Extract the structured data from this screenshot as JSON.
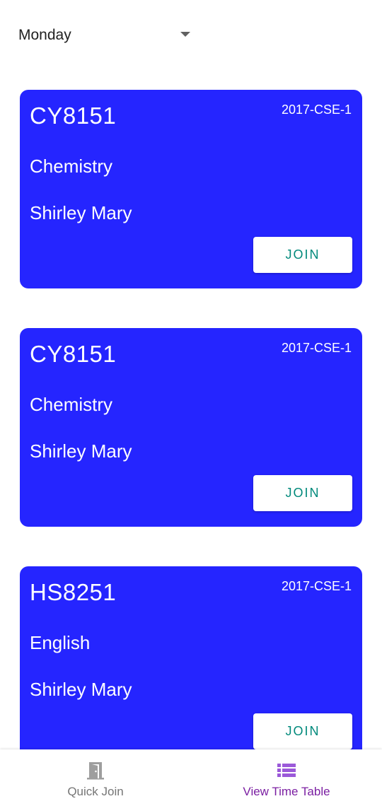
{
  "day_selector": {
    "selected": "Monday"
  },
  "classes": [
    {
      "code": "CY8151",
      "batch": "2017-CSE-1",
      "subject": "Chemistry",
      "teacher": "Shirley Mary",
      "join_label": "JOIN"
    },
    {
      "code": "CY8151",
      "batch": "2017-CSE-1",
      "subject": "Chemistry",
      "teacher": "Shirley Mary",
      "join_label": "JOIN"
    },
    {
      "code": "HS8251",
      "batch": "2017-CSE-1",
      "subject": "English",
      "teacher": "Shirley Mary",
      "join_label": "JOIN"
    }
  ],
  "bottom_nav": {
    "items": [
      {
        "label": "Quick Join",
        "icon": "door-icon",
        "active": false
      },
      {
        "label": "View Time Table",
        "icon": "list-icon",
        "active": true
      }
    ]
  },
  "colors": {
    "card_background": "#2525ff",
    "join_text": "#00897b",
    "active_nav": "#7b1fa2",
    "active_icon": "#9b59d9",
    "inactive_nav": "#757575"
  }
}
